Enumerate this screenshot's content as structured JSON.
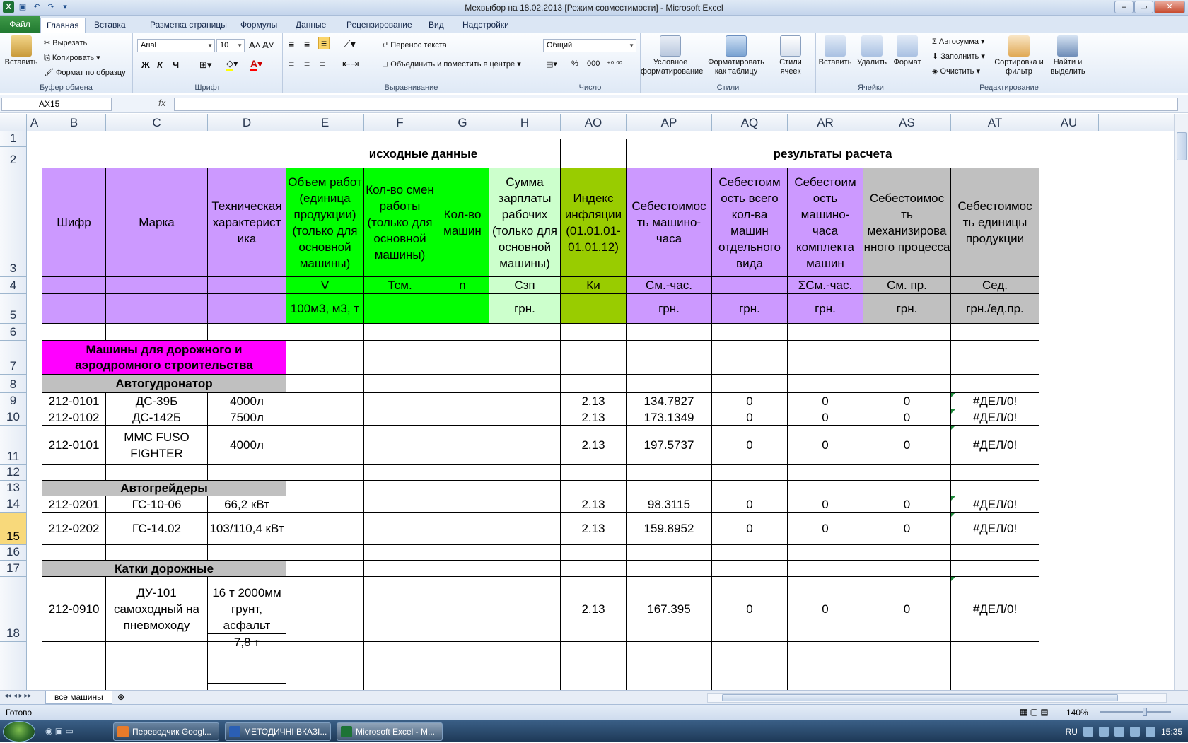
{
  "window": {
    "title": "Мехвыбор на 18.02.2013  [Режим совместимости]  -  Microsoft Excel"
  },
  "ribbon_tabs": [
    "Файл",
    "Главная",
    "Вставка",
    "Разметка страницы",
    "Формулы",
    "Данные",
    "Рецензирование",
    "Вид",
    "Надстройки"
  ],
  "ribbon": {
    "clipboard": {
      "label": "Буфер обмена",
      "paste": "Вставить",
      "cut": "Вырезать",
      "copy": "Копировать",
      "format_painter": "Формат по образцу"
    },
    "font": {
      "label": "Шрифт",
      "name": "Arial",
      "size": "10",
      "bold": "Ж",
      "italic": "К",
      "underline": "Ч"
    },
    "alignment": {
      "label": "Выравнивание",
      "wrap": "Перенос текста",
      "merge": "Объединить и поместить в центре"
    },
    "number": {
      "label": "Число",
      "format": "Общий",
      "percent": "%",
      "thousands": "000"
    },
    "styles": {
      "label": "Стили",
      "conditional": "Условное форматирование",
      "as_table": "Форматировать как таблицу",
      "cell_styles": "Стили ячеек"
    },
    "cells": {
      "label": "Ячейки",
      "insert": "Вставить",
      "delete": "Удалить",
      "format": "Формат"
    },
    "editing": {
      "label": "Редактирование",
      "autosum": "Автосумма",
      "fill": "Заполнить",
      "clear": "Очистить",
      "sort": "Сортировка и фильтр",
      "find": "Найти и выделить"
    }
  },
  "formula_bar": {
    "name_box": "AX15",
    "fx": "fx",
    "value": ""
  },
  "columns": [
    "A",
    "B",
    "C",
    "D",
    "E",
    "F",
    "G",
    "H",
    "AO",
    "AP",
    "AQ",
    "AR",
    "AS",
    "AT",
    "AU"
  ],
  "rows": [
    "1",
    "2",
    "3",
    "4",
    "5",
    "6",
    "7",
    "8",
    "9",
    "10",
    "11",
    "12",
    "13",
    "14",
    "15",
    "16",
    "17",
    "18"
  ],
  "sheet": {
    "section_input": "исходные данные",
    "section_results": "результаты расчета",
    "headers": {
      "cipher": "Шифр",
      "brand": "Марка",
      "tech": "Техническая характерист ика",
      "volume": "Объем работ (единица продукции) (только для основной машины)",
      "shifts": "Кол-во смен работы (только для основной машины)",
      "machines": "Кол-во машин",
      "salary": "Сумма зарплаты рабочих (только для основной машины)",
      "inflation": "Индекс инфляции (01.01.01- 01.01.12)",
      "hour_cost": "Себестоимос ть машино- часа",
      "total_cost": "Себестоим ость всего кол-ва машин отдельного вида",
      "set_cost": "Себестоим ость машино- часа комплекта машин",
      "process_cost": "Себестоимос ть механизирова нного процесса",
      "unit_cost": "Себестоимос ть единицы продукции"
    },
    "symbols": {
      "volume": "V",
      "shifts": "Тсм.",
      "machines": "n",
      "salary": "Сзп",
      "inflation": "Ки",
      "hour_cost": "См.-час.",
      "set_cost": "ΣСм.-час.",
      "process_cost": "См. пр.",
      "unit_cost": "Сед."
    },
    "units": {
      "volume": "100м3, м3, т",
      "salary": "грн.",
      "hour_cost": "грн.",
      "total_cost": "грн.",
      "set_cost": "грн.",
      "process_cost": "грн.",
      "unit_cost": "грн./ед.пр."
    },
    "category": "Машины для дорожного и аэродромного строительства",
    "groups": {
      "g1": "Автогудронатор",
      "g2": "Автогрейдеры",
      "g3": "Катки дорожные"
    },
    "data_rows": [
      {
        "cipher": "212-0101",
        "brand": "ДС-39Б",
        "tech": "4000л",
        "ki": "2.13",
        "hour": "134.7827",
        "total": "0",
        "set": "0",
        "proc": "0",
        "unit": "#ДЕЛ/0!"
      },
      {
        "cipher": "212-0102",
        "brand": "ДС-142Б",
        "tech": "7500л",
        "ki": "2.13",
        "hour": "173.1349",
        "total": "0",
        "set": "0",
        "proc": "0",
        "unit": "#ДЕЛ/0!"
      },
      {
        "cipher": "212-0101",
        "brand": "MMC FUSO FIGHTER",
        "tech": "4000л",
        "ki": "2.13",
        "hour": "197.5737",
        "total": "0",
        "set": "0",
        "proc": "0",
        "unit": "#ДЕЛ/0!"
      },
      {
        "cipher": "212-0201",
        "brand": "ГС-10-06",
        "tech": "66,2 кВт",
        "ki": "2.13",
        "hour": "98.3115",
        "total": "0",
        "set": "0",
        "proc": "0",
        "unit": "#ДЕЛ/0!"
      },
      {
        "cipher": "212-0202",
        "brand": "ГС-14.02",
        "tech": "103/110,4 кВт",
        "ki": "2.13",
        "hour": "159.8952",
        "total": "0",
        "set": "0",
        "proc": "0",
        "unit": "#ДЕЛ/0!"
      },
      {
        "cipher": "212-0910",
        "brand": "ДУ-101 самоходный на пневмоходу",
        "tech": "16 т 2000мм грунт, асфальт",
        "ki": "2.13",
        "hour": "167.395",
        "total": "0",
        "set": "0",
        "proc": "0",
        "unit": "#ДЕЛ/0!"
      }
    ],
    "partial_next": "7,8 т"
  },
  "sheet_tab": "все машины",
  "status": {
    "ready": "Готово",
    "zoom": "140%"
  },
  "taskbar": {
    "items": [
      "Переводчик Googl...",
      "МЕТОДИЧНІ ВКАЗІ...",
      "Microsoft Excel - М..."
    ],
    "lang": "RU",
    "time": "15:35"
  },
  "colors": {
    "violet": "#cc99ff",
    "green": "#00ff00",
    "lightgreen": "#ccffcc",
    "olive": "#99cc00",
    "gray": "#c0c0c0",
    "magenta": "#ff00ff"
  }
}
